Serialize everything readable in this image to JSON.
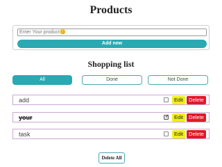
{
  "page": {
    "title": "Products"
  },
  "add_form": {
    "placeholder": "Enter Your product😊",
    "add_button": "Add new"
  },
  "shopping": {
    "title": "Shopping list",
    "filters": [
      {
        "label": "All",
        "active": true
      },
      {
        "label": "Done",
        "active": false
      },
      {
        "label": "Not Done",
        "active": false
      }
    ],
    "items": [
      {
        "text": "add",
        "checked": false,
        "edit": "Edit",
        "delete": "Delete"
      },
      {
        "text": "your",
        "checked": true,
        "edit": "Edit",
        "delete": "Delete"
      },
      {
        "text": "task",
        "checked": false,
        "edit": "Edit",
        "delete": "Delete"
      }
    ],
    "delete_all": "Delete All"
  },
  "colors": {
    "accent": "#2aa9b2",
    "edit": "#f2ee1a",
    "delete": "#e1182b",
    "row_border": "#c9a9cf"
  }
}
